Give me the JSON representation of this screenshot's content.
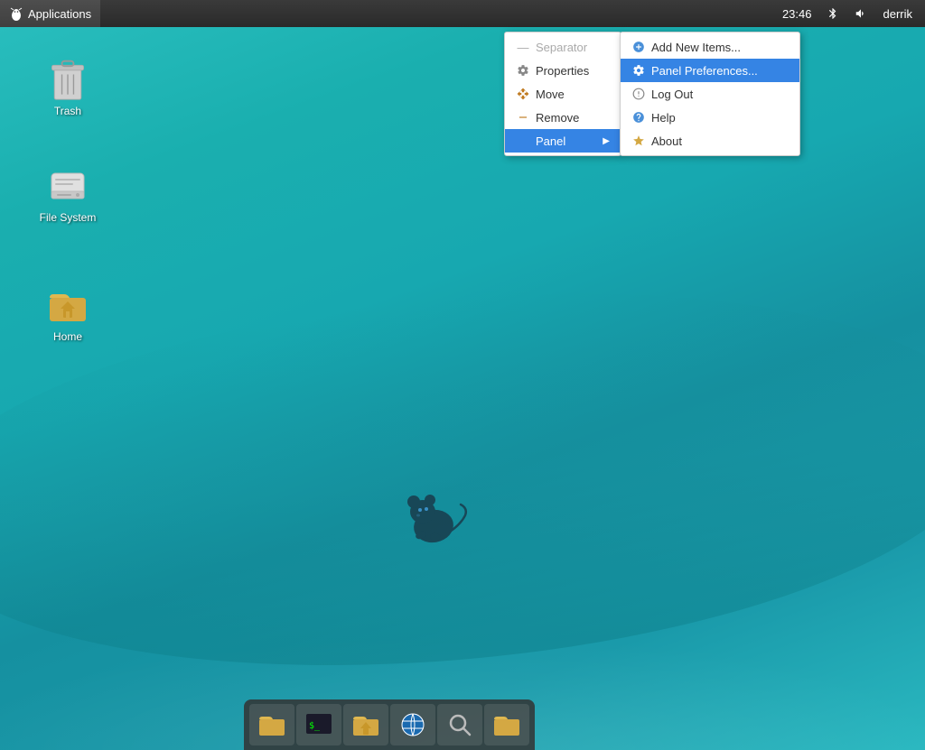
{
  "topPanel": {
    "applications_label": "Applications",
    "time": "23:46",
    "user": "derrik",
    "bluetooth_label": "bluetooth",
    "volume_label": "volume"
  },
  "desktop": {
    "icons": [
      {
        "id": "trash",
        "label": "Trash",
        "type": "trash"
      },
      {
        "id": "filesystem",
        "label": "File System",
        "type": "filesystem"
      },
      {
        "id": "home",
        "label": "Home",
        "type": "home"
      }
    ]
  },
  "contextMenu": {
    "separator_label": "Separator",
    "properties_label": "Properties",
    "move_label": "Move",
    "remove_label": "Remove",
    "panel_label": "Panel",
    "items": [
      {
        "id": "separator",
        "label": "Separator",
        "disabled": true
      },
      {
        "id": "properties",
        "label": "Properties"
      },
      {
        "id": "move",
        "label": "Move"
      },
      {
        "id": "remove",
        "label": "Remove"
      },
      {
        "id": "panel",
        "label": "Panel",
        "hasSubmenu": true
      }
    ]
  },
  "panelSubmenu": {
    "items": [
      {
        "id": "add-new-items",
        "label": "Add New Items..."
      },
      {
        "id": "panel-preferences",
        "label": "Panel Preferences...",
        "highlighted": true
      },
      {
        "id": "log-out",
        "label": "Log Out"
      },
      {
        "id": "help",
        "label": "Help"
      },
      {
        "id": "about",
        "label": "About"
      }
    ]
  },
  "taskbar": {
    "buttons": [
      {
        "id": "files",
        "icon": "folder"
      },
      {
        "id": "terminal",
        "icon": "terminal"
      },
      {
        "id": "home-files",
        "icon": "home-folder"
      },
      {
        "id": "network",
        "icon": "network"
      },
      {
        "id": "search",
        "icon": "search"
      },
      {
        "id": "extra-folder",
        "icon": "folder2"
      }
    ]
  }
}
